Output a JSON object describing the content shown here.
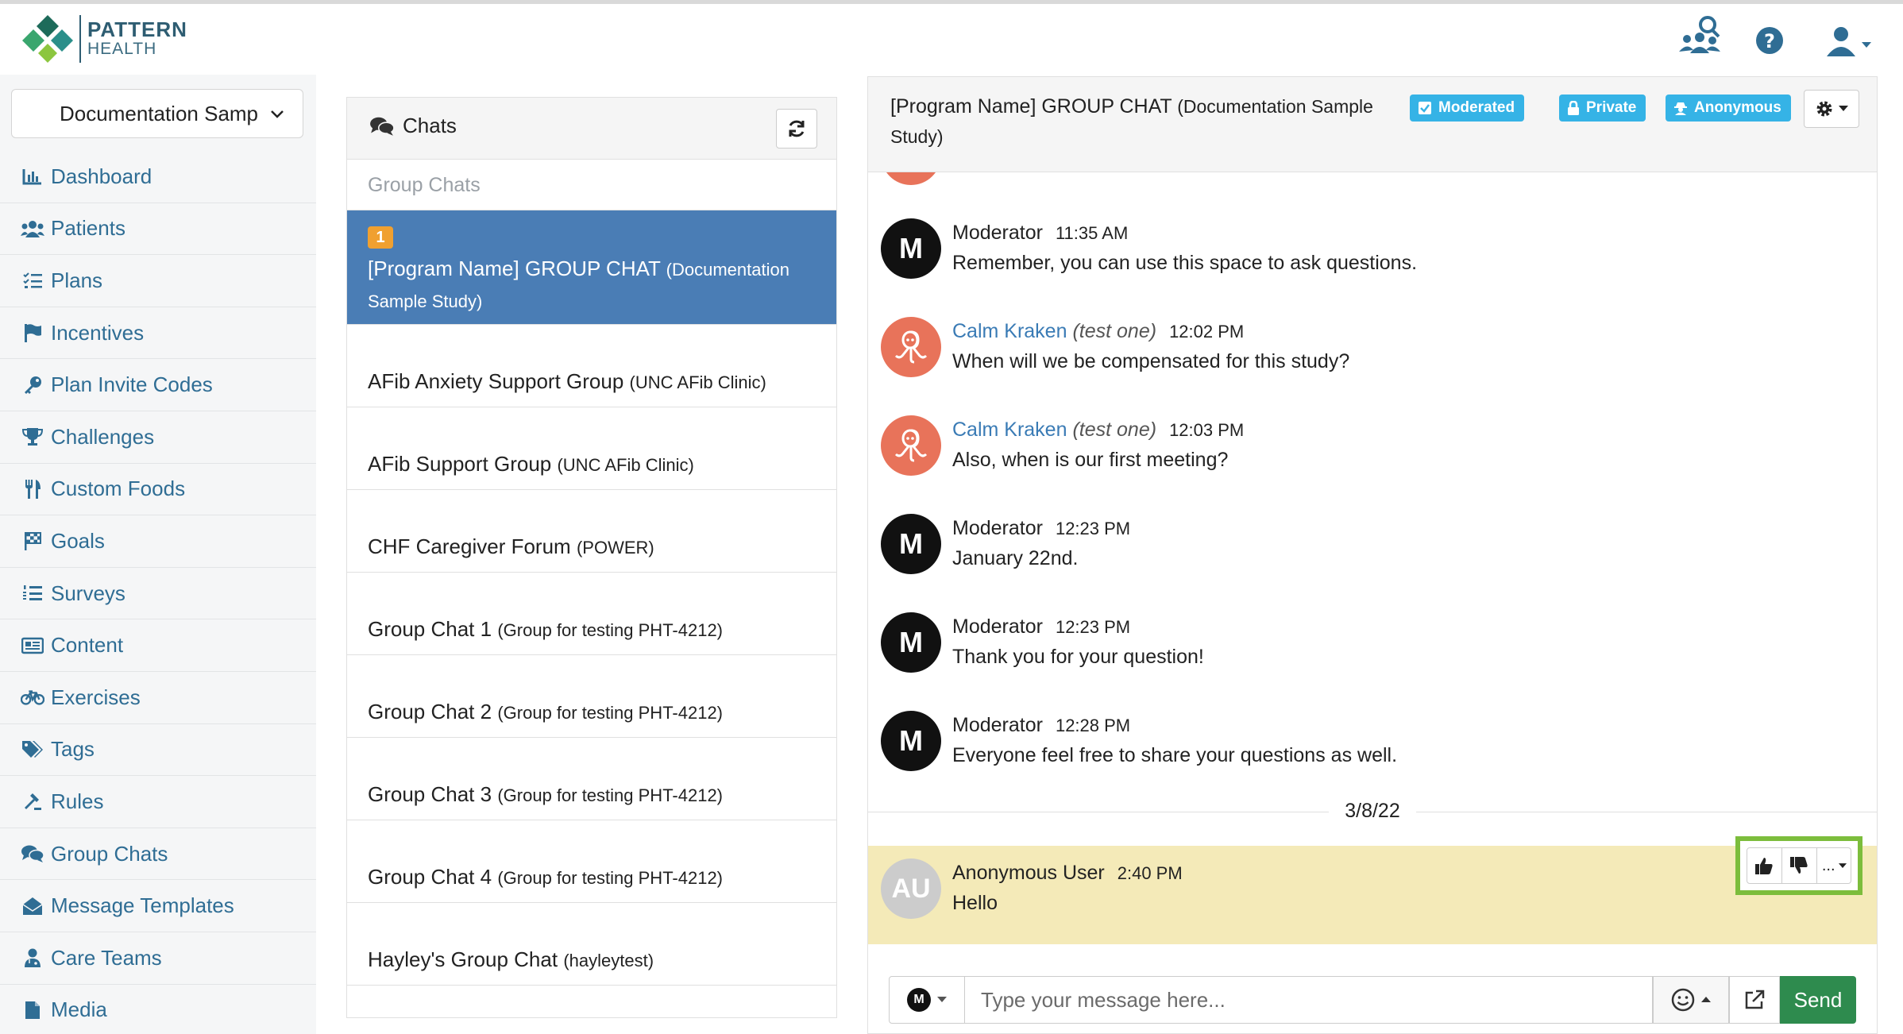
{
  "brand": {
    "line1": "PATTERN",
    "line2": "HEALTH"
  },
  "sidebar": {
    "program_select": "Documentation Samp",
    "items": [
      {
        "label": "Dashboard",
        "icon": "bar-chart-icon"
      },
      {
        "label": "Patients",
        "icon": "users-icon"
      },
      {
        "label": "Plans",
        "icon": "tasks-icon"
      },
      {
        "label": "Incentives",
        "icon": "flag-icon"
      },
      {
        "label": "Plan Invite Codes",
        "icon": "key-icon"
      },
      {
        "label": "Challenges",
        "icon": "trophy-icon"
      },
      {
        "label": "Custom Foods",
        "icon": "utensils-icon"
      },
      {
        "label": "Goals",
        "icon": "checkered-flag-icon"
      },
      {
        "label": "Surveys",
        "icon": "list-ol-icon"
      },
      {
        "label": "Content",
        "icon": "newspaper-icon"
      },
      {
        "label": "Exercises",
        "icon": "bicycle-icon"
      },
      {
        "label": "Tags",
        "icon": "tags-icon"
      },
      {
        "label": "Rules",
        "icon": "gavel-icon"
      },
      {
        "label": "Group Chats",
        "icon": "comments-icon"
      },
      {
        "label": "Message Templates",
        "icon": "envelope-open-icon"
      },
      {
        "label": "Care Teams",
        "icon": "user-md-icon"
      },
      {
        "label": "Media",
        "icon": "file-icon"
      }
    ]
  },
  "chatlist": {
    "title": "Chats",
    "section": "Group Chats",
    "active": {
      "badge": "1",
      "name": "[Program Name] GROUP CHAT",
      "sub": "(Documentation Sample Study)"
    },
    "items": [
      {
        "name": "AFib Anxiety Support Group",
        "sub": "(UNC AFib Clinic)"
      },
      {
        "name": "AFib Support Group",
        "sub": "(UNC AFib Clinic)"
      },
      {
        "name": "CHF Caregiver Forum",
        "sub": "(POWER)"
      },
      {
        "name": "Group Chat 1",
        "sub": "(Group for testing PHT-4212)"
      },
      {
        "name": "Group Chat 2",
        "sub": "(Group for testing PHT-4212)"
      },
      {
        "name": "Group Chat 3",
        "sub": "(Group for testing PHT-4212)"
      },
      {
        "name": "Group Chat 4",
        "sub": "(Group for testing PHT-4212)"
      },
      {
        "name": "Hayley's Group Chat",
        "sub": "(hayleytest)"
      }
    ]
  },
  "conversation": {
    "title": "[Program Name] GROUP CHAT",
    "title_sub": "(Documentation Sample Study)",
    "tags": {
      "moderated": "Moderated",
      "private": "Private",
      "anonymous": "Anonymous"
    },
    "messages": [
      {
        "initial": "M",
        "author": "Moderator",
        "paren": "",
        "time": "11:35 AM",
        "text": "Remember, you can use this space to ask questions."
      },
      {
        "initial": "",
        "author": "Calm Kraken",
        "paren": "(test one)",
        "time": "12:02 PM",
        "text": "When will we be compensated for this study?"
      },
      {
        "initial": "",
        "author": "Calm Kraken",
        "paren": "(test one)",
        "time": "12:03 PM",
        "text": "Also, when is our first meeting?"
      },
      {
        "initial": "M",
        "author": "Moderator",
        "paren": "",
        "time": "12:23 PM",
        "text": "January 22nd."
      },
      {
        "initial": "M",
        "author": "Moderator",
        "paren": "",
        "time": "12:23 PM",
        "text": "Thank you for your question!"
      },
      {
        "initial": "M",
        "author": "Moderator",
        "paren": "",
        "time": "12:28 PM",
        "text": "Everyone feel free to share your questions as well."
      }
    ],
    "date_separator": "3/8/22",
    "highlighted": {
      "initial": "AU",
      "author": "Anonymous User",
      "time": "2:40 PM",
      "text": "Hello"
    },
    "actions": {
      "more": "..."
    }
  },
  "composer": {
    "user_initial": "M",
    "placeholder": "Type your message here...",
    "send": "Send"
  },
  "colors": {
    "accent": "#4a7db5",
    "link": "#2f6d94",
    "tag": "#35b3e6",
    "send": "#2e8b4e",
    "highlight": "#f4eab8",
    "focus_box": "#7cbd3c"
  }
}
